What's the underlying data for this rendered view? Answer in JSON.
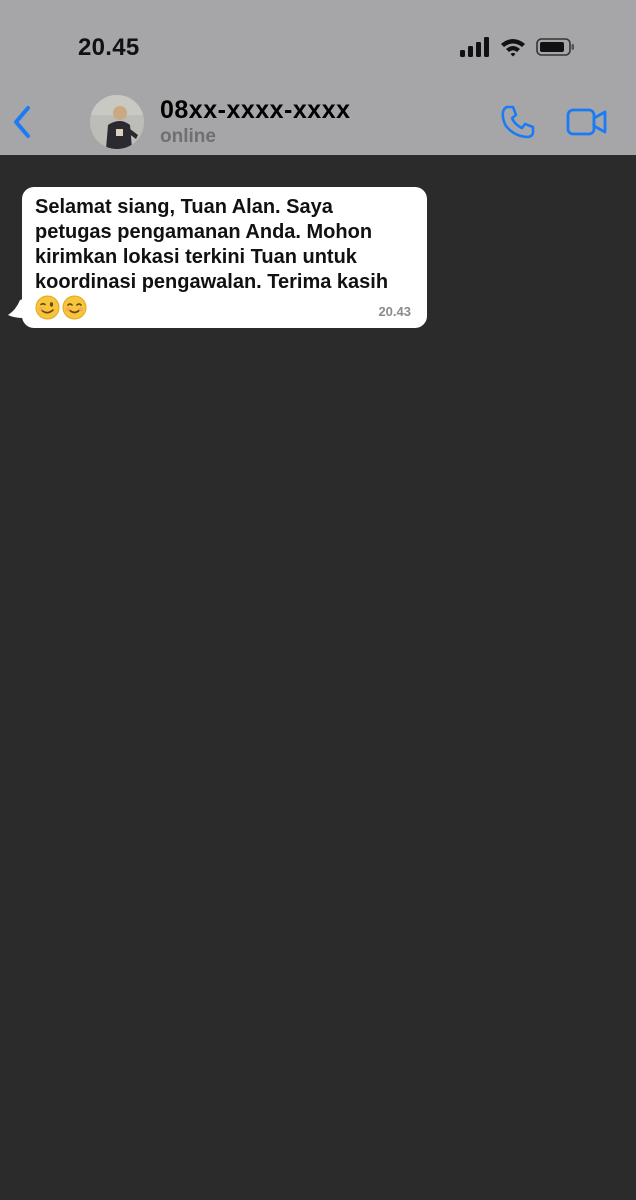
{
  "status_bar": {
    "time": "20.45",
    "icons": [
      "signal-icon",
      "wifi-icon",
      "battery-icon"
    ]
  },
  "header": {
    "back_icon": "chevron-left-icon",
    "contact_name": "08xx-xxxx-xxxx",
    "contact_status": "online",
    "actions": [
      "phone-icon",
      "video-camera-icon"
    ]
  },
  "messages": [
    {
      "direction": "incoming",
      "text": "Selamat siang, Tuan Alan. Saya\npetugas pengamanan Anda. Mohon\nkirimkan lokasi terkini Tuan untuk\nkoordinasi pengawalan. Terima kasih",
      "emojis": [
        "winking-face-emoji",
        "smiling-face-emoji"
      ],
      "time": "20.43"
    }
  ],
  "colors": {
    "header_bg": "#a6a6a8",
    "chat_bg": "#2b2b2b",
    "accent": "#1a7cf5",
    "bubble_bg": "#ffffff"
  }
}
